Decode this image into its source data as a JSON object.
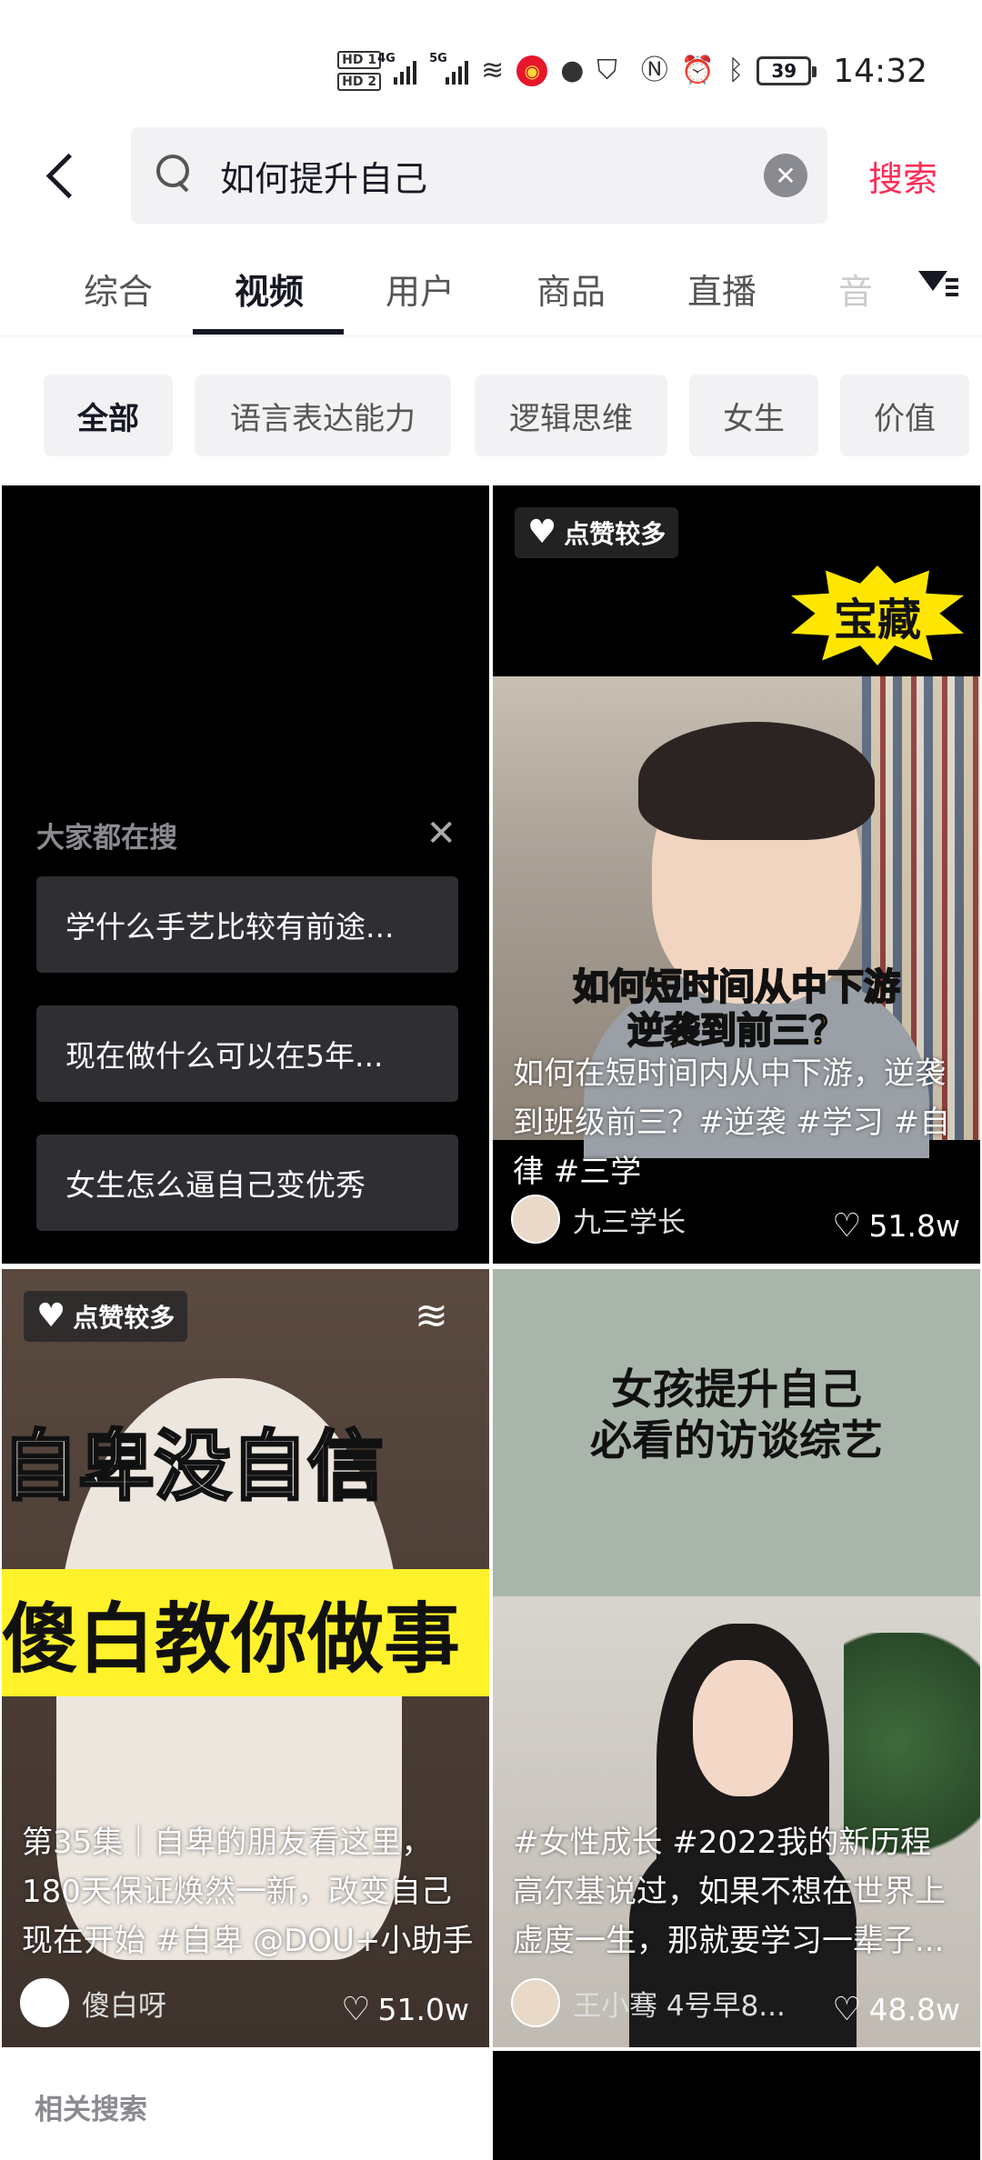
{
  "status_bar": {
    "hd1": "HD 1",
    "hd2": "HD 2",
    "net1": "4G",
    "net2": "5G",
    "battery": "39",
    "time": "14:32"
  },
  "search": {
    "query": "如何提升自己",
    "submit_label": "搜索"
  },
  "tabs": [
    {
      "label": "综合"
    },
    {
      "label": "视频",
      "active": true
    },
    {
      "label": "用户"
    },
    {
      "label": "商品"
    },
    {
      "label": "直播"
    },
    {
      "label": "音"
    }
  ],
  "chips": [
    {
      "label": "全部",
      "active": true
    },
    {
      "label": "语言表达能力"
    },
    {
      "label": "逻辑思维"
    },
    {
      "label": "女生"
    },
    {
      "label": "价值"
    }
  ],
  "suggestions": {
    "heading": "大家都在搜",
    "items": [
      {
        "text": "学什么手艺比较有前途..."
      },
      {
        "text": "现在做什么可以在5年..."
      },
      {
        "text": "女生怎么逼自己变优秀"
      }
    ]
  },
  "cards": [
    {
      "badge": "点赞较多",
      "sticker": "宝藏",
      "overlay_line1": "如何短时间从中下游",
      "overlay_line2": "逆袭到前三？",
      "title_lines": [
        "如何在短时间内从中下游，逆袭",
        "到班级前三？#逆袭 #学习 #自",
        "律 #三学"
      ],
      "author": "九三学长",
      "likes": "51.8w"
    },
    {
      "badge": "点赞较多",
      "overlay_line1": "自卑没自信",
      "overlay_line2": "傻白教你做事",
      "title_lines": [
        "第35集｜自卑的朋友看这里，",
        "180天保证焕然一新，改变自己",
        "现在开始 #自卑 @DOU+小助手"
      ],
      "author": "傻白呀",
      "likes": "51.0w"
    },
    {
      "heading_line1": "女孩提升自己",
      "heading_line2": "必看的访谈综艺",
      "title_lines": [
        "#女性成长 #2022我的新历程",
        "高尔基说过，如果不想在世界上",
        "虚度一生，那就要学习一辈子..."
      ],
      "author": "王小骞 4号早8...",
      "likes": "48.8w"
    }
  ],
  "related_heading": "相关搜索"
}
